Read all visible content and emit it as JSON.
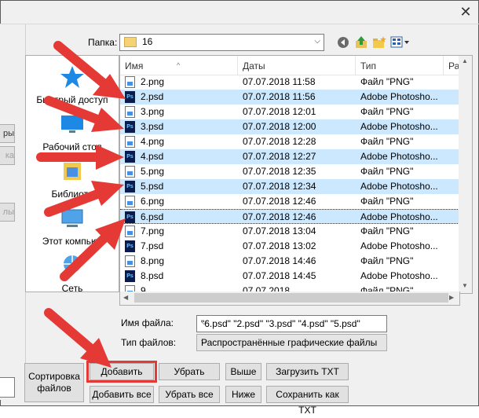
{
  "window": {
    "close_label": "✕"
  },
  "toolbar": {
    "folder_label": "Папка:",
    "folder_value": "16",
    "icons": [
      "back-icon",
      "up-folder-icon",
      "new-folder-icon",
      "view-menu-icon"
    ]
  },
  "left_stub": {
    "button_top_label": "ры",
    "button_mid_label": "ка",
    "button_low_label": "лы"
  },
  "places": [
    {
      "label": "Быстрый доступ",
      "icon": "star-icon"
    },
    {
      "label": "Рабочий стол",
      "icon": "desktop-icon"
    },
    {
      "label": "Библиоте",
      "icon": "libraries-icon"
    },
    {
      "label": "Этот компьют",
      "icon": "computer-icon"
    },
    {
      "label": "Сеть",
      "icon": "network-icon"
    }
  ],
  "columns": {
    "name": "Имя",
    "date": "Даты",
    "type": "Тип",
    "size": "Ра"
  },
  "files": [
    {
      "name": "2.png",
      "date": "07.07.2018 11:58",
      "type": "Файл \"PNG\"",
      "kind": "png",
      "selected": false
    },
    {
      "name": "2.psd",
      "date": "07.07.2018 11:56",
      "type": "Adobe Photosho...",
      "kind": "psd",
      "selected": true
    },
    {
      "name": "3.png",
      "date": "07.07.2018 12:01",
      "type": "Файл \"PNG\"",
      "kind": "png",
      "selected": false
    },
    {
      "name": "3.psd",
      "date": "07.07.2018 12:00",
      "type": "Adobe Photosho...",
      "kind": "psd",
      "selected": true
    },
    {
      "name": "4.png",
      "date": "07.07.2018 12:28",
      "type": "Файл \"PNG\"",
      "kind": "png",
      "selected": false
    },
    {
      "name": "4.psd",
      "date": "07.07.2018 12:27",
      "type": "Adobe Photosho...",
      "kind": "psd",
      "selected": true
    },
    {
      "name": "5.png",
      "date": "07.07.2018 12:35",
      "type": "Файл \"PNG\"",
      "kind": "png",
      "selected": false
    },
    {
      "name": "5.psd",
      "date": "07.07.2018 12:34",
      "type": "Adobe Photosho...",
      "kind": "psd",
      "selected": true
    },
    {
      "name": "6.png",
      "date": "07.07.2018 12:46",
      "type": "Файл \"PNG\"",
      "kind": "png",
      "selected": false
    },
    {
      "name": "6.psd",
      "date": "07.07.2018 12:46",
      "type": "Adobe Photosho...",
      "kind": "psd",
      "selected": true,
      "focused": true
    },
    {
      "name": "7.png",
      "date": "07.07.2018 13:04",
      "type": "Файл \"PNG\"",
      "kind": "png",
      "selected": false
    },
    {
      "name": "7.psd",
      "date": "07.07.2018 13:02",
      "type": "Adobe Photosho...",
      "kind": "psd",
      "selected": false
    },
    {
      "name": "8.png",
      "date": "07.07.2018 14:46",
      "type": "Файл \"PNG\"",
      "kind": "png",
      "selected": false
    },
    {
      "name": "8.psd",
      "date": "07.07.2018 14:45",
      "type": "Adobe Photosho...",
      "kind": "psd",
      "selected": false
    },
    {
      "name": "9...",
      "date": "07.07.2018 ...",
      "type": "Файл \"PNG\"",
      "kind": "png",
      "selected": false
    }
  ],
  "filename": {
    "label": "Имя файла:",
    "value": "\"6.psd\" \"2.psd\" \"3.psd\" \"4.psd\" \"5.psd\""
  },
  "filetype": {
    "label": "Тип файлов:",
    "value": "Распространённые графические файлы"
  },
  "buttons": {
    "sort_line1": "Сортировка",
    "sort_line2": "файлов",
    "add": "Добавить",
    "remove": "Убрать",
    "up": "Выше",
    "load_txt": "Загрузить TXT",
    "add_all": "Добавить все",
    "remove_all": "Убрать все",
    "down": "Ниже",
    "save_txt": "Сохранить как TXT"
  },
  "colors": {
    "selection": "#cce8ff",
    "arrow_red": "#e53935",
    "psd_icon": "#0b1b4e"
  }
}
